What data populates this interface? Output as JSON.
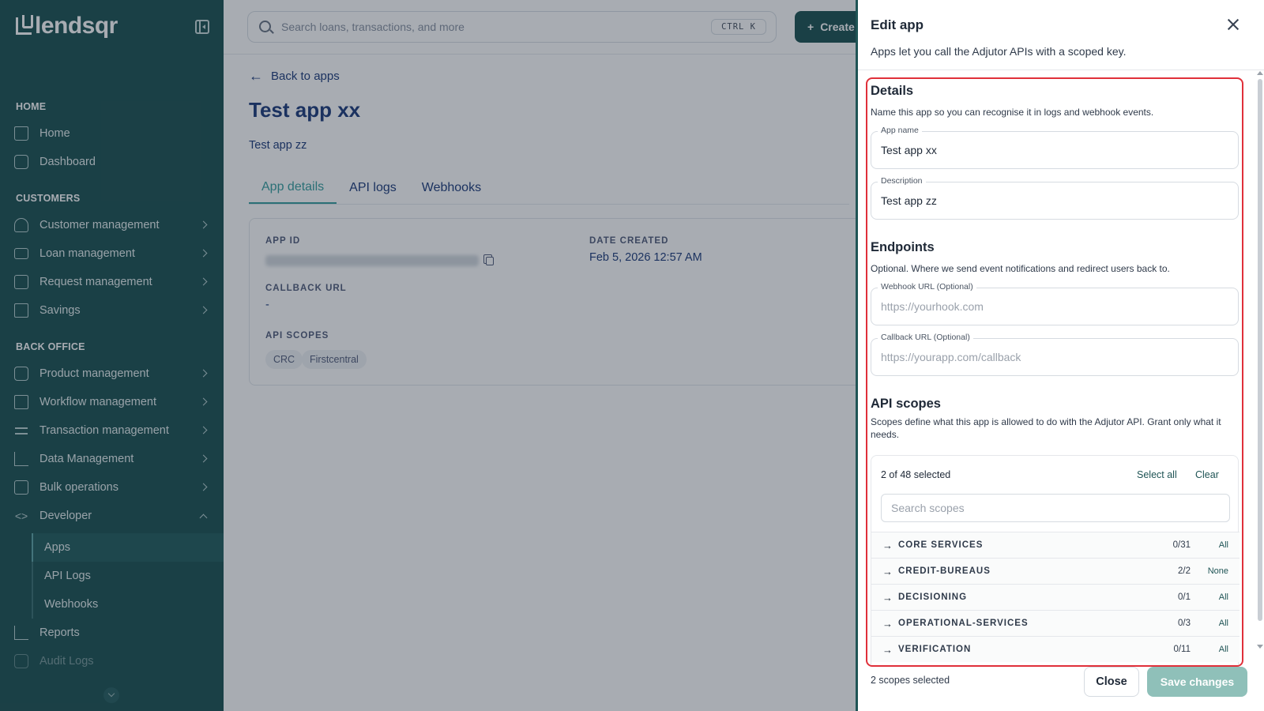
{
  "sidebar": {
    "logo_text": "lendsqr",
    "sections": {
      "home": "HOME",
      "customers": "CUSTOMERS",
      "back_office": "BACK OFFICE"
    },
    "items": {
      "home": "Home",
      "dashboard": "Dashboard",
      "customer_management": "Customer management",
      "loan_management": "Loan management",
      "request_management": "Request management",
      "savings": "Savings",
      "product_management": "Product management",
      "workflow_management": "Workflow management",
      "transaction_management": "Transaction management",
      "data_management": "Data Management",
      "bulk_operations": "Bulk operations",
      "developer": "Developer",
      "apps": "Apps",
      "api_logs": "API Logs",
      "webhooks": "Webhooks",
      "reports": "Reports",
      "audit_logs": "Audit Logs"
    }
  },
  "topbar": {
    "search_placeholder": "Search loans, transactions, and more",
    "shortcut": "CTRL K",
    "create_label": "Create"
  },
  "main": {
    "back_label": "Back to apps",
    "title": "Test app xx",
    "description": "Test app zz",
    "tabs": [
      "App details",
      "API logs",
      "Webhooks"
    ],
    "details": {
      "app_id_label": "APP ID",
      "date_created_label": "DATE CREATED",
      "date_created": "Feb 5, 2026 12:57 AM",
      "callback_url_label": "CALLBACK URL",
      "callback_url": "-",
      "api_scopes_label": "API SCOPES",
      "scopes": [
        "CRC",
        "Firstcentral"
      ]
    }
  },
  "drawer": {
    "title": "Edit app",
    "subtitle": "Apps let you call the Adjutor APIs with a scoped key.",
    "details": {
      "title": "Details",
      "desc": "Name this app so you can recognise it in logs and webhook events.",
      "app_name_label": "App name",
      "app_name": "Test app xx",
      "description_label": "Description",
      "description": "Test app zz"
    },
    "endpoints": {
      "title": "Endpoints",
      "desc": "Optional. Where we send event notifications and redirect users back to.",
      "webhook_label": "Webhook URL (Optional)",
      "webhook_placeholder": "https://yourhook.com",
      "callback_label": "Callback URL (Optional)",
      "callback_placeholder": "https://yourapp.com/callback"
    },
    "scopes": {
      "title": "API scopes",
      "desc": "Scopes define what this app is allowed to do with the Adjutor API. Grant only what it needs.",
      "count_text": "2 of 48 selected",
      "select_all": "Select all",
      "clear": "Clear",
      "search_placeholder": "Search scopes",
      "groups": [
        {
          "name": "CORE SERVICES",
          "count": "0/31",
          "action": "All"
        },
        {
          "name": "CREDIT-BUREAUS",
          "count": "2/2",
          "action": "None"
        },
        {
          "name": "DECISIONING",
          "count": "0/1",
          "action": "All"
        },
        {
          "name": "OPERATIONAL-SERVICES",
          "count": "0/3",
          "action": "All"
        },
        {
          "name": "VERIFICATION",
          "count": "0/11",
          "action": "All"
        }
      ]
    },
    "footer": {
      "selected_text": "2 scopes selected",
      "close_label": "Close",
      "save_label": "Save changes"
    }
  }
}
